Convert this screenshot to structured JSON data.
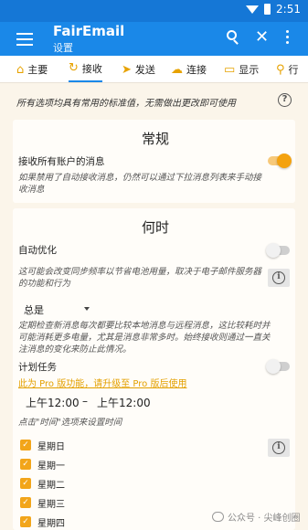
{
  "status": {
    "time": "2:51"
  },
  "app": {
    "title": "FairEmail",
    "subtitle": "设置"
  },
  "tabs": [
    {
      "icon": "home-icon",
      "label": "主要"
    },
    {
      "icon": "sync-icon",
      "label": "接收"
    },
    {
      "icon": "send-icon",
      "label": "发送"
    },
    {
      "icon": "cloud-icon",
      "label": "连接"
    },
    {
      "icon": "display-icon",
      "label": "显示"
    },
    {
      "icon": "behavior-icon",
      "label": "行"
    }
  ],
  "note": "所有选项均具有常用的标准值，无需做出更改即可使用",
  "general": {
    "title": "常规",
    "poll_label": "接收所有账户的消息",
    "poll_on": true,
    "poll_desc": "如果禁用了自动接收消息，仍然可以通过下拉消息列表来手动接收消息"
  },
  "when": {
    "title": "何时",
    "optimize_label": "自动优化",
    "optimize_on": false,
    "optimize_desc": "这可能会改变同步频率以节省电池用量，取决于电子邮件服务器的功能和行为",
    "interval_value": "总是",
    "interval_desc": "定期检查新消息每次都要比较本地消息与远程消息，这比较耗时并可能消耗更多电量，尤其是消息非常多时。始终接收则通过一直关注消息的变化来防止此情况。",
    "schedule_label": "计划任务",
    "schedule_on": false,
    "pro_text": "此为 Pro 版功能，请升级至 Pro 版后使用",
    "time_start": "上午12:00",
    "time_dash": "–",
    "time_end": "上午12:00",
    "time_hint": "点击\"时间\"选项来设置时间",
    "days": [
      "星期日",
      "星期一",
      "星期二",
      "星期三",
      "星期四"
    ]
  },
  "watermark": "公众号 · 尖峰创圈",
  "colors": {
    "primary": "#1a88e8",
    "status_bar": "#1577d6",
    "accent": "#f4a20f",
    "background": "#fbf5ea"
  }
}
